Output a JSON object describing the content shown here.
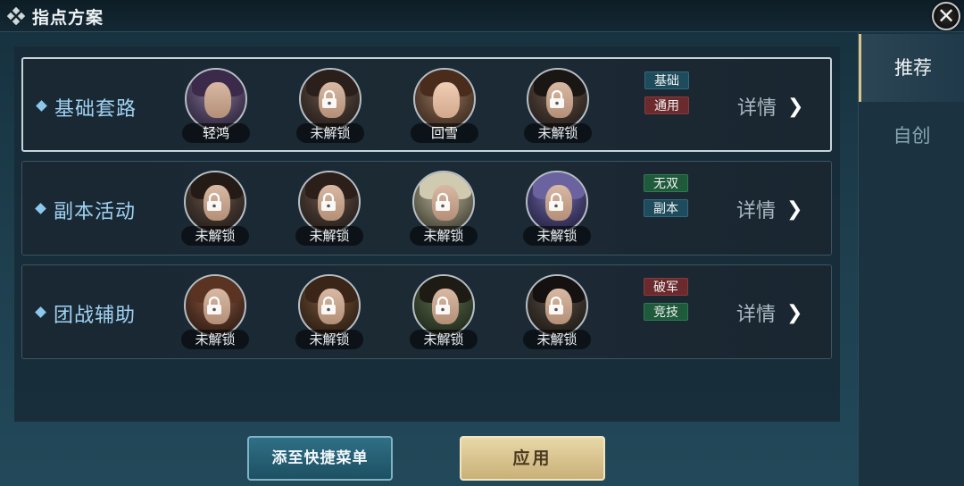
{
  "window": {
    "title": "指点方案",
    "close_icon": "close-x-icon"
  },
  "side_tabs": [
    {
      "label": "推荐",
      "active": true
    },
    {
      "label": "自创",
      "active": false
    }
  ],
  "schemes": [
    {
      "name": "基础套路",
      "selected": true,
      "heroes": [
        {
          "label": "轻鸿",
          "locked": false
        },
        {
          "label": "未解锁",
          "locked": true
        },
        {
          "label": "回雪",
          "locked": false
        },
        {
          "label": "未解锁",
          "locked": true
        }
      ],
      "tags": [
        {
          "text": "基础",
          "color": "blue"
        },
        {
          "text": "通用",
          "color": "red"
        }
      ],
      "detail": "详情"
    },
    {
      "name": "副本活动",
      "selected": false,
      "heroes": [
        {
          "label": "未解锁",
          "locked": true
        },
        {
          "label": "未解锁",
          "locked": true
        },
        {
          "label": "未解锁",
          "locked": true
        },
        {
          "label": "未解锁",
          "locked": true
        }
      ],
      "tags": [
        {
          "text": "无双",
          "color": "green"
        },
        {
          "text": "副本",
          "color": "blue"
        }
      ],
      "detail": "详情"
    },
    {
      "name": "团战辅助",
      "selected": false,
      "heroes": [
        {
          "label": "未解锁",
          "locked": true
        },
        {
          "label": "未解锁",
          "locked": true
        },
        {
          "label": "未解锁",
          "locked": true
        },
        {
          "label": "未解锁",
          "locked": true
        }
      ],
      "tags": [
        {
          "text": "破军",
          "color": "red"
        },
        {
          "text": "竞技",
          "color": "green"
        }
      ],
      "detail": "详情"
    }
  ],
  "buttons": {
    "quick_menu": "添至快捷菜单",
    "apply": "应用"
  },
  "colors": {
    "accent_gold": "#d8c58d",
    "row_name": "#9fd2f2",
    "tag_blue": "#1f4c5c",
    "tag_red": "#6b2a2d",
    "tag_green": "#1e5a3b"
  }
}
